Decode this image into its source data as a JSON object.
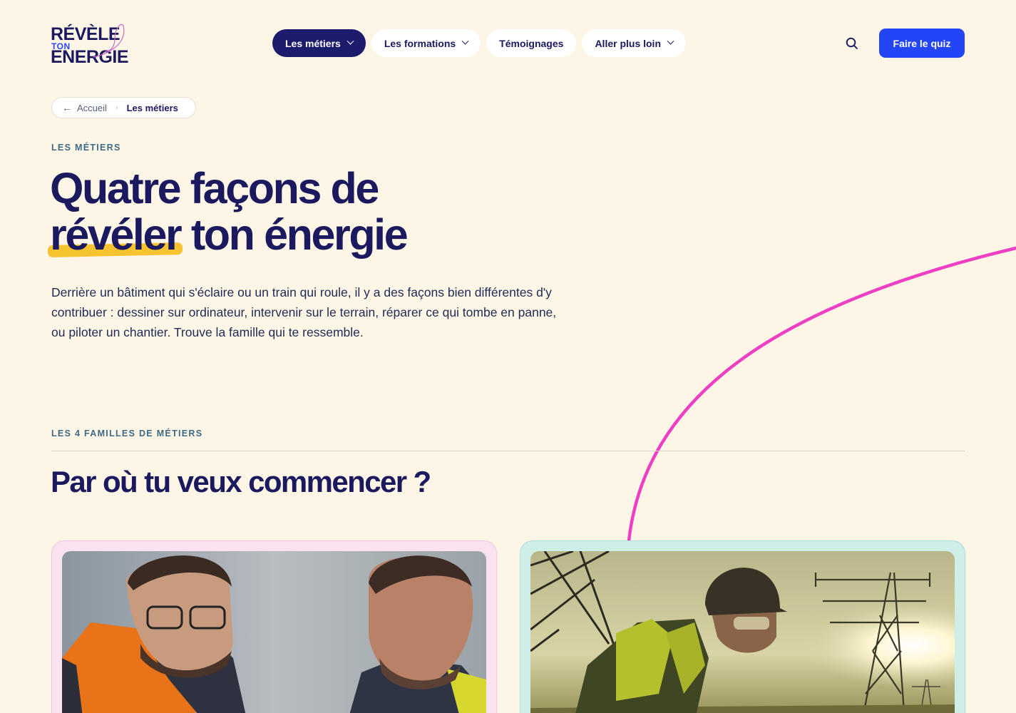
{
  "brand": {
    "logo_line1": "RÉVÈLE",
    "logo_line2": "TON",
    "logo_line3": "ENERGIE",
    "accent_color": "#2445f5",
    "navy_color": "#1b1a5e",
    "highlight_color": "#f6c331",
    "curve_color": "#ec3fc4"
  },
  "nav": {
    "items": [
      {
        "label": "Les métiers",
        "dropdown": true,
        "active": true
      },
      {
        "label": "Les formations",
        "dropdown": true,
        "active": false
      },
      {
        "label": "Témoignages",
        "dropdown": false,
        "active": false
      },
      {
        "label": "Aller plus loin",
        "dropdown": true,
        "active": false
      }
    ],
    "search_icon": "search-icon",
    "quiz_label": "Faire le quiz"
  },
  "breadcrumb": {
    "back_icon": "arrow-left-icon",
    "home": "Accueil",
    "current": "Les métiers"
  },
  "hero": {
    "eyebrow": "LES MÉTIERS",
    "title_line1": "Quatre façons de",
    "title_highlight": "révéler",
    "title_rest": "ton énergie",
    "description": "Derrière un bâtiment qui s'éclaire ou un train qui roule, il y a des façons bien différentes d'y contribuer : dessiner sur ordinateur, intervenir sur le terrain, réparer ce qui tombe en panne, ou piloter un chantier. Trouve la famille qui te ressemble."
  },
  "families": {
    "eyebrow": "LES 4 FAMILLES DE MÉTIERS",
    "title": "Par où tu veux commencer ?",
    "cards": [
      {
        "image": "two-workers-reviewing-plans-photo",
        "color": "#fbe2f1"
      },
      {
        "image": "worker-near-power-pylons-photo",
        "color": "#cfeee8"
      }
    ]
  }
}
